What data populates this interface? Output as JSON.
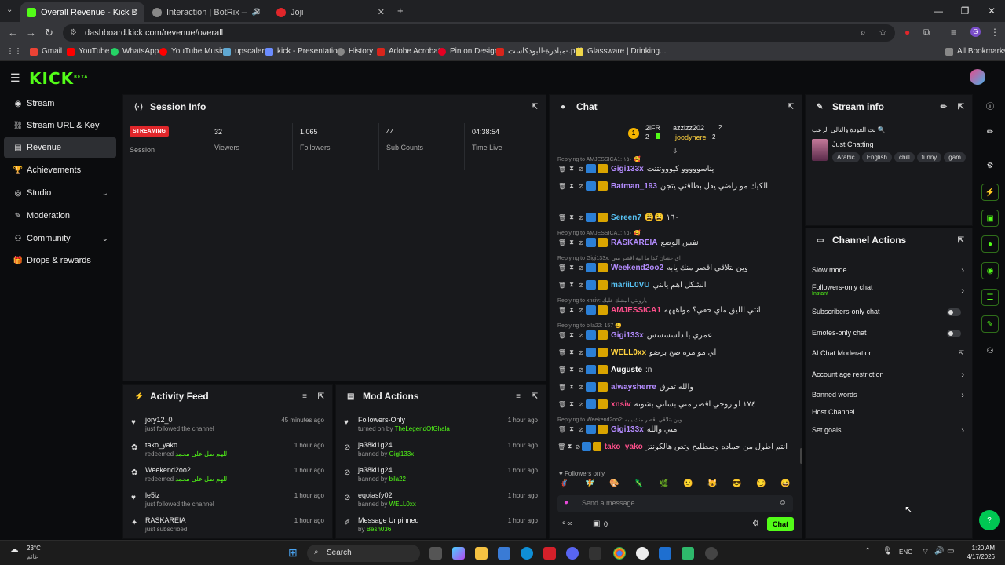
{
  "browser": {
    "tabs": [
      {
        "title": "Overall Revenue - Kick Dashboa"
      },
      {
        "title": "Interaction | BotRix — Clou"
      },
      {
        "title": "Joji"
      }
    ],
    "url": "dashboard.kick.com/revenue/overall",
    "bookmarks": [
      "Gmail",
      "YouTube",
      "WhatsApp",
      "YouTube Music",
      "upscaler",
      "kick - Presentation",
      "History",
      "Adobe Acrobat",
      "Pin on Design",
      "مبادرة-البودكاست-.pdf",
      "Glassware | Drinking...",
      "All Bookmarks"
    ]
  },
  "kick": {
    "logo": "KICK",
    "logo_sup": "BETA"
  },
  "sidebar": {
    "items": [
      {
        "label": "Stream",
        "icon": "broadcast-icon"
      },
      {
        "label": "Stream URL & Key",
        "icon": "link-icon"
      },
      {
        "label": "Revenue",
        "icon": "chart-icon"
      },
      {
        "label": "Achievements",
        "icon": "trophy-icon"
      },
      {
        "label": "Studio",
        "icon": "globe-icon"
      },
      {
        "label": "Moderation",
        "icon": "wrench-icon"
      },
      {
        "label": "Community",
        "icon": "users-icon"
      },
      {
        "label": "Drops & rewards",
        "icon": "gift-icon"
      }
    ]
  },
  "session": {
    "title": "Session Info",
    "status_badge": "STREAMING",
    "status_label": "Session",
    "stats": [
      {
        "value": "32",
        "label": "Viewers"
      },
      {
        "value": "1,065",
        "label": "Followers"
      },
      {
        "value": "44",
        "label": "Sub Counts"
      },
      {
        "value": "04:38:54",
        "label": "Time Live"
      }
    ]
  },
  "activity": {
    "title": "Activity Feed",
    "items": [
      {
        "name": "jory12_0",
        "sub": "just followed the channel",
        "time": "45 minutes ago",
        "icon": "heart-icon",
        "reward": ""
      },
      {
        "name": "tako_yako",
        "sub": "redeemed",
        "time": "1 hour ago",
        "icon": "reward-icon",
        "reward": "اللهم صل على محمد"
      },
      {
        "name": "Weekend2oo2",
        "sub": "redeemed",
        "time": "1 hour ago",
        "icon": "reward-icon",
        "reward": "اللهم صل على محمد"
      },
      {
        "name": "le5iz",
        "sub": "just followed the channel",
        "time": "1 hour ago",
        "icon": "heart-icon",
        "reward": ""
      },
      {
        "name": "RASKAREIA",
        "sub": "just subscribed",
        "time": "1 hour ago",
        "icon": "star-icon",
        "reward": ""
      }
    ]
  },
  "mod": {
    "title": "Mod Actions",
    "items": [
      {
        "name": "Followers-Only",
        "sub": "turned on by",
        "by": "TheLegendOfGhala",
        "time": "1 hour ago",
        "icon": "heart-icon"
      },
      {
        "name": "ja38ki1g24",
        "sub": "banned by",
        "by": "Gigi133x",
        "time": "1 hour ago",
        "icon": "ban-icon"
      },
      {
        "name": "ja38ki1g24",
        "sub": "banned by",
        "by": "bila22",
        "time": "1 hour ago",
        "icon": "ban-icon"
      },
      {
        "name": "eqoiasfy02",
        "sub": "banned by",
        "by": "WELL0xx",
        "time": "1 hour ago",
        "icon": "ban-icon"
      },
      {
        "name": "Message Unpinned",
        "sub": "by",
        "by": "Besh036",
        "time": "1 hour ago",
        "icon": "pin-icon"
      }
    ]
  },
  "chat": {
    "title": "Chat",
    "top_gifters": [
      {
        "name": "2iFR",
        "count": "2"
      },
      {
        "name": "azzizz202",
        "count": "2"
      },
      {
        "name": "joodyhere",
        "count": "2"
      }
    ],
    "messages": [
      {
        "reply": "Replying to AMJESSICA1: ١٥٠ 🥰",
        "user": "Gigi133x",
        "color": "#b48cff",
        "text": "يناسووووو كيوووتتتت"
      },
      {
        "reply": "",
        "user": "Batman_193",
        "color": "#b48cff",
        "text": "الكيك مو راضي يقل بطاقتي يتجن"
      },
      {
        "reply": "",
        "user": "Sereen7",
        "color": "#58c3f5",
        "text": "١٦٠ 😩😩"
      },
      {
        "reply": "Replying to AMJESSICA1: ١٥٠ 🥰",
        "user": "RASKAREIA",
        "color": "#b48cff",
        "text": "نفس الوضع"
      },
      {
        "reply": "Replying to Gigi133x: اي عشان كذا ما ابيه اقصر مني",
        "user": "Weekend2oo2",
        "color": "#b48cff",
        "text": "وين بتلاقي اقصر منك يابه"
      },
      {
        "reply": "",
        "user": "mariiL0VU",
        "color": "#58c3f5",
        "text": "الشكل اهم يابني"
      },
      {
        "reply": "Replying to xnsiv: ياروبتي انبشك عليك",
        "user": "AMJESSICA1",
        "color": "#ff4f8b",
        "text": "انتي الليق ماي حقي؟ مواهههه"
      },
      {
        "reply": "Replying to bila22: 157 😩",
        "user": "Gigi133x",
        "color": "#b48cff",
        "text": "عمري يا دلسسسس"
      },
      {
        "reply": "",
        "user": "WELL0xx",
        "color": "#ffd23f",
        "text": "اي مو مره صح برضو"
      },
      {
        "reply": "",
        "user": "Auguste",
        "color": "#ffffff",
        "text": "n:"
      },
      {
        "reply": "",
        "user": "alwaysherre",
        "color": "#b48cff",
        "text": "والله تفرق"
      },
      {
        "reply": "",
        "user": "xnsiv",
        "color": "#ff4f8b",
        "text": "١٧٤ لو زوجي اقصر مني بساني بشوته"
      },
      {
        "reply": "Replying to Weekend2oo2: وين بتلاقي اقصر منك يابه",
        "user": "Gigi133x",
        "color": "#b48cff",
        "text": "مني والله"
      },
      {
        "reply": "",
        "user": "tako_yako",
        "color": "#ff4f8b",
        "text": "انتم اطول من حماده وصطليح وتص هالكونتز"
      }
    ],
    "followers_only": "Followers only",
    "placeholder": "Send a message",
    "points": "0",
    "send_label": "Chat"
  },
  "stream_info": {
    "title": "Stream info",
    "stream_title": "بث العودة والتالي الرعب 🔍",
    "category": "Just Chatting",
    "tags": [
      "Arabic",
      "English",
      "chill",
      "funny",
      "gam"
    ]
  },
  "actions": {
    "title": "Channel Actions",
    "items": [
      {
        "label": "Slow mode",
        "sub": "",
        "ctl": "arrow"
      },
      {
        "label": "Followers-only chat",
        "sub": "Instant",
        "ctl": "arrow"
      },
      {
        "label": "Subscribers-only chat",
        "sub": "",
        "ctl": "toggle"
      },
      {
        "label": "Emotes-only chat",
        "sub": "",
        "ctl": "toggle"
      },
      {
        "label": "AI Chat Moderation",
        "sub": "",
        "ctl": "external"
      },
      {
        "label": "Account age restriction",
        "sub": "",
        "ctl": "arrow"
      },
      {
        "label": "Banned words",
        "sub": "",
        "ctl": "arrow"
      },
      {
        "label": "Host Channel",
        "sub": "",
        "ctl": "none"
      },
      {
        "label": "Set goals",
        "sub": "",
        "ctl": "arrow"
      }
    ]
  },
  "taskbar": {
    "weather_temp": "23°C",
    "weather_text": "غائم",
    "search": "Search",
    "lang": "ENG",
    "time": "1:20 AM",
    "date": "4/17/2026"
  }
}
